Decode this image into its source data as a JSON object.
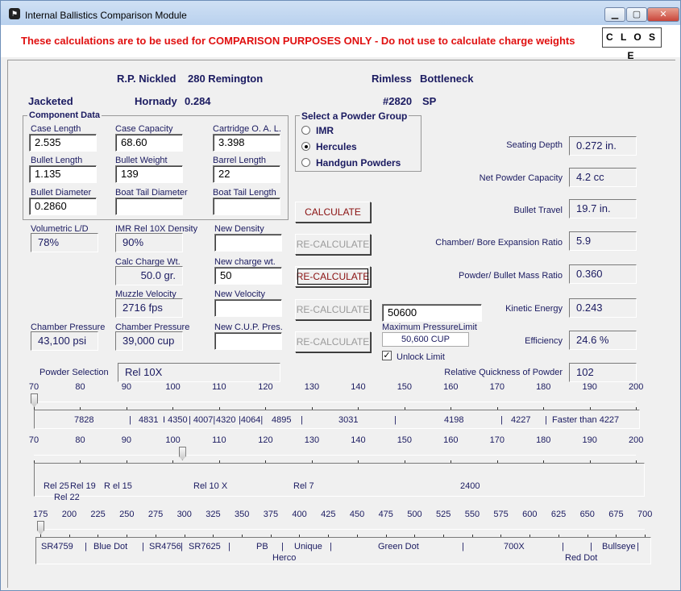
{
  "window": {
    "title": "Internal Ballistics Comparison Module"
  },
  "banner": {
    "warning": "These calculations are to be used for COMPARISON PURPOSES ONLY - Do not use to calculate charge weights",
    "close_label": "C L O S E"
  },
  "header": {
    "row1": [
      "R.P. Nickled",
      "280 Remington",
      "Rimless",
      "Bottleneck"
    ],
    "row2": [
      "Jacketed",
      "Hornady",
      "0.284",
      "#2820",
      "SP"
    ]
  },
  "component": {
    "legend": "Component Data",
    "case_length": {
      "label": "Case Length",
      "value": "2.535"
    },
    "case_capacity": {
      "label": "Case Capacity",
      "value": "68.60"
    },
    "coal": {
      "label": "Cartridge O. A. L.",
      "value": "3.398"
    },
    "bullet_length": {
      "label": "Bullet Length",
      "value": "1.135"
    },
    "bullet_weight": {
      "label": "Bullet Weight",
      "value": "139"
    },
    "barrel_length": {
      "label": "Barrel Length",
      "value": "22"
    },
    "bullet_diameter": {
      "label": "Bullet Diameter",
      "value": "0.2860"
    },
    "boat_tail_diameter": {
      "label": "Boat Tail Diameter",
      "value": ""
    },
    "boat_tail_length": {
      "label": "Boat Tail Length",
      "value": ""
    }
  },
  "powder_group": {
    "legend": "Select a Powder Group",
    "options": [
      "IMR",
      "Hercules",
      "Handgun Powders"
    ],
    "selected": "Hercules"
  },
  "results": {
    "volumetric_ld": {
      "label": "Volumetric L/D",
      "value": "78%"
    },
    "density": {
      "label": "IMR Rel 10X Density",
      "value": "90%"
    },
    "new_density": {
      "label": "New Density",
      "value": ""
    },
    "calc_charge": {
      "label": "Calc Charge Wt.",
      "value": "50.0 gr."
    },
    "new_charge": {
      "label": "New charge wt.",
      "value": "50"
    },
    "muzzle_velocity": {
      "label": "Muzzle Velocity",
      "value": "2716 fps"
    },
    "new_velocity": {
      "label": "New Velocity",
      "value": ""
    },
    "chamber_psi": {
      "label": "Chamber Pressure",
      "value": "43,100 psi"
    },
    "chamber_cup": {
      "label": "Chamber Pressure",
      "value": "39,000 cup"
    },
    "new_cup": {
      "label": "New C.U.P. Pres.",
      "value": ""
    }
  },
  "buttons": {
    "calculate": "CALCULATE",
    "recalc1": "RE-CALCULATE",
    "recalc2": "RE-CALCULATE",
    "recalc3": "RE-CALCULATE",
    "recalc4": "RE-CALCULATE"
  },
  "max_pressure": {
    "value": "50600",
    "label": "Maximum PressureLimit",
    "display": "50,600 CUP",
    "unlock_label": "Unlock Limit",
    "unlock_checked": true
  },
  "right": {
    "seating_depth": {
      "label": "Seating Depth",
      "value": "0.272 in."
    },
    "net_capacity": {
      "label": "Net Powder Capacity",
      "value": "4.2 cc"
    },
    "bullet_travel": {
      "label": "Bullet Travel",
      "value": "19.7 in."
    },
    "expansion": {
      "label": "Chamber/ Bore Expansion Ratio",
      "value": "5.9"
    },
    "mass_ratio": {
      "label": "Powder/ Bullet Mass Ratio",
      "value": "0.360"
    },
    "kinetic": {
      "label": "Kinetic Energy",
      "value": "0.243"
    },
    "efficiency": {
      "label": "Efficiency",
      "value": "24.6 %"
    },
    "quickness": {
      "label": "Relative Quickness of Powder",
      "value": "102"
    }
  },
  "powder_selection": {
    "label": "Powder Selection",
    "value": "Rel 10X"
  },
  "scale1": {
    "ticks": [
      "70",
      "80",
      "90",
      "100",
      "110",
      "120",
      "130",
      "140",
      "150",
      "160",
      "170",
      "180",
      "190",
      "200"
    ],
    "thumb_value": 70,
    "powders": [
      "7828",
      "|",
      "4831",
      "I 4350",
      "| 4007|",
      "4320",
      "|4064|",
      "4895",
      "|",
      "3031",
      "|",
      "4198",
      "|",
      "4227",
      "|",
      "Faster than 4227"
    ]
  },
  "scale2": {
    "ticks": [
      "70",
      "80",
      "90",
      "100",
      "110",
      "120",
      "130",
      "140",
      "150",
      "160",
      "170",
      "180",
      "190",
      "200"
    ],
    "thumb_value": 102,
    "powders": [
      "Rel 25",
      "Rel 19",
      "R el 15",
      "Rel 10 X",
      "Rel 7",
      "2400",
      "Rel 22"
    ]
  },
  "scale3": {
    "ticks": [
      "175",
      "200",
      "225",
      "250",
      "275",
      "300",
      "325",
      "350",
      "375",
      "400",
      "425",
      "450",
      "475",
      "500",
      "525",
      "550",
      "575",
      "600",
      "625",
      "650",
      "675",
      "700"
    ],
    "thumb_value": 175,
    "powders": [
      "SR4759",
      "|",
      "Blue Dot",
      "|",
      "SR4756",
      "|",
      "SR7625",
      "|",
      "PB",
      "|",
      "Unique",
      "|",
      "Green Dot",
      "|",
      "700X",
      "|",
      "|",
      "Bullseye",
      "|",
      "Herco",
      "Red Dot"
    ]
  }
}
